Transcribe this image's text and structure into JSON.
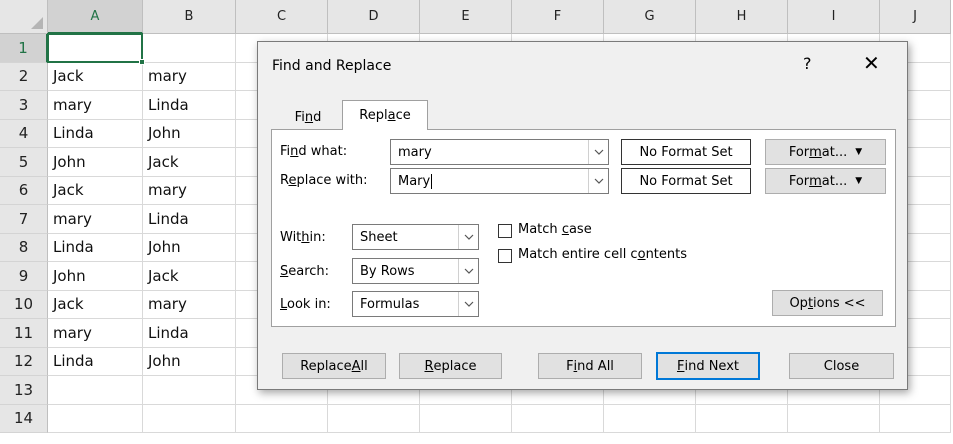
{
  "sheet": {
    "columns": [
      "A",
      "B",
      "C",
      "D",
      "E",
      "F",
      "G",
      "H",
      "I",
      "J"
    ],
    "rows": [
      "1",
      "2",
      "3",
      "4",
      "5",
      "6",
      "7",
      "8",
      "9",
      "10",
      "11",
      "12",
      "13",
      "14"
    ],
    "col_a": [
      "",
      "Jack",
      "mary",
      "Linda",
      "John",
      "Jack",
      "mary",
      "Linda",
      "John",
      "Jack",
      "mary",
      "Linda",
      "",
      ""
    ],
    "col_b": [
      "",
      "mary",
      "Linda",
      "John",
      "Jack",
      "mary",
      "Linda",
      "John",
      "Jack",
      "mary",
      "Linda",
      "John",
      "",
      ""
    ],
    "accent_color": "#217346"
  },
  "dialog": {
    "title": "Find and Replace",
    "help": "?",
    "close": "✕",
    "tabs": {
      "find": {
        "pre": "Fi",
        "key": "n",
        "post": "d"
      },
      "replace": {
        "pre": "Repl",
        "key": "a",
        "post": "ce"
      }
    },
    "find_what": {
      "label_pre": "Fi",
      "label_key": "n",
      "label_post": "d what:",
      "value": "mary",
      "format_status": "No Format Set",
      "format_btn": {
        "pre": "For",
        "key": "m",
        "post": "at..."
      }
    },
    "replace_with": {
      "label_pre": "R",
      "label_key": "e",
      "label_post": "place with:",
      "value": "Mary",
      "format_status": "No Format Set",
      "format_btn": {
        "pre": "For",
        "key": "m",
        "post": "at..."
      }
    },
    "within": {
      "label_pre": "Wit",
      "label_key": "h",
      "label_post": "in:",
      "value": "Sheet"
    },
    "search": {
      "label_pre": "",
      "label_key": "S",
      "label_post": "earch:",
      "value": "By Rows"
    },
    "look_in": {
      "label_pre": "",
      "label_key": "L",
      "label_post": "ook in:",
      "value": "Formulas"
    },
    "match_case": {
      "pre": "Match ",
      "key": "c",
      "post": "ase",
      "checked": false
    },
    "match_entire": {
      "pre": "Match entire cell c",
      "key": "o",
      "post": "ntents",
      "checked": false
    },
    "options_btn": {
      "pre": "Op",
      "key": "t",
      "post": "ions <<"
    },
    "buttons": {
      "replace_all": {
        "pre": "Replace ",
        "key": "A",
        "post": "ll"
      },
      "replace": {
        "pre": "",
        "key": "R",
        "post": "eplace"
      },
      "find_all": {
        "pre": "F",
        "key": "i",
        "post": "nd All"
      },
      "find_next": {
        "pre": "",
        "key": "F",
        "post": "ind Next"
      },
      "close": "Close"
    },
    "focus_color": "#0078d7"
  }
}
